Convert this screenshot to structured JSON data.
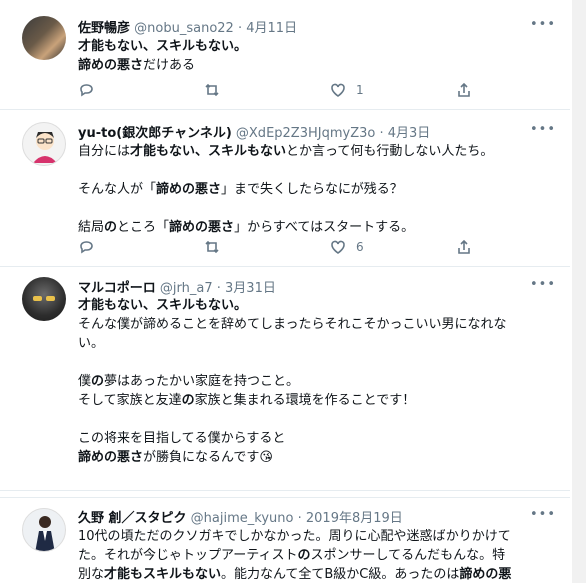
{
  "tweets": [
    {
      "name": "佐野暢彦",
      "handle": "@nobu_sano22",
      "date": "4月11日",
      "more": "•••",
      "lines": [
        "才能もない、スキルもない。"
      ],
      "line2_bold": "諦めの悪さ",
      "line2_rest": "だけある",
      "stats": {
        "reply": "",
        "retweet": "",
        "like": "1",
        "share": ""
      }
    },
    {
      "name": "yu-to(銀次郎チャンネル)",
      "handle": "@XdEp2Z3HJqmyZ3o",
      "date": "4月3日",
      "more": "•••",
      "p1_a": "自分には",
      "p1_b": "才能もない、スキルもない",
      "p1_c": "とか言って何も行動しない人たち。",
      "p2_a": "そんな人が「",
      "p2_b": "諦めの悪さ",
      "p2_c": "」まで失くしたらなにが残る？",
      "p3_a": "結局",
      "p3_b": "の",
      "p3_c": "ところ「",
      "p3_d": "諦めの悪さ",
      "p3_e": "」からすべてはスタートする。",
      "stats": {
        "reply": "",
        "retweet": "",
        "like": "6",
        "share": ""
      }
    },
    {
      "name": "マルコポーロ",
      "handle": "@jrh_a7",
      "date": "3月31日",
      "more": "•••",
      "l1": "才能もない、スキルもない。",
      "l2": "そんな僕が諦めることを辞めてしまったらそれこそかっこいい男になれな",
      "l3": "い。",
      "l4_a": "僕",
      "l4_b": "の",
      "l4_c": "夢はあったかい家庭を持つこと。",
      "l5_a": "そして家族と友達",
      "l5_b": "の",
      "l5_c": "家族と集まれる環境を作ることです！",
      "l6": "この将来を目指してる僕からすると",
      "l7_a": "諦めの悪さ",
      "l7_b": "が勝負になるんです",
      "emoji": "😘"
    },
    {
      "name": "久野 創／スタピク",
      "handle": "@hajime_kyuno",
      "date": "2019年8月19日",
      "more": "•••",
      "l1": "10代の頃ただのクソガキでしかなかった。周りに心配や迷惑ばかりかけて",
      "l2_a": "た。それが今じゃトップアーティスト",
      "l2_b": "の",
      "l2_c": "スポンサーしてるんだもんな。特",
      "l3_a": "別な",
      "l3_b": "才能もスキルもない",
      "l3_c": "。能力なんて全てB級かC級。あったのは",
      "l3_d": "諦めの悪"
    }
  ],
  "icons": [
    "reply-icon",
    "retweet-icon",
    "like-icon",
    "share-icon",
    "more-icon"
  ]
}
